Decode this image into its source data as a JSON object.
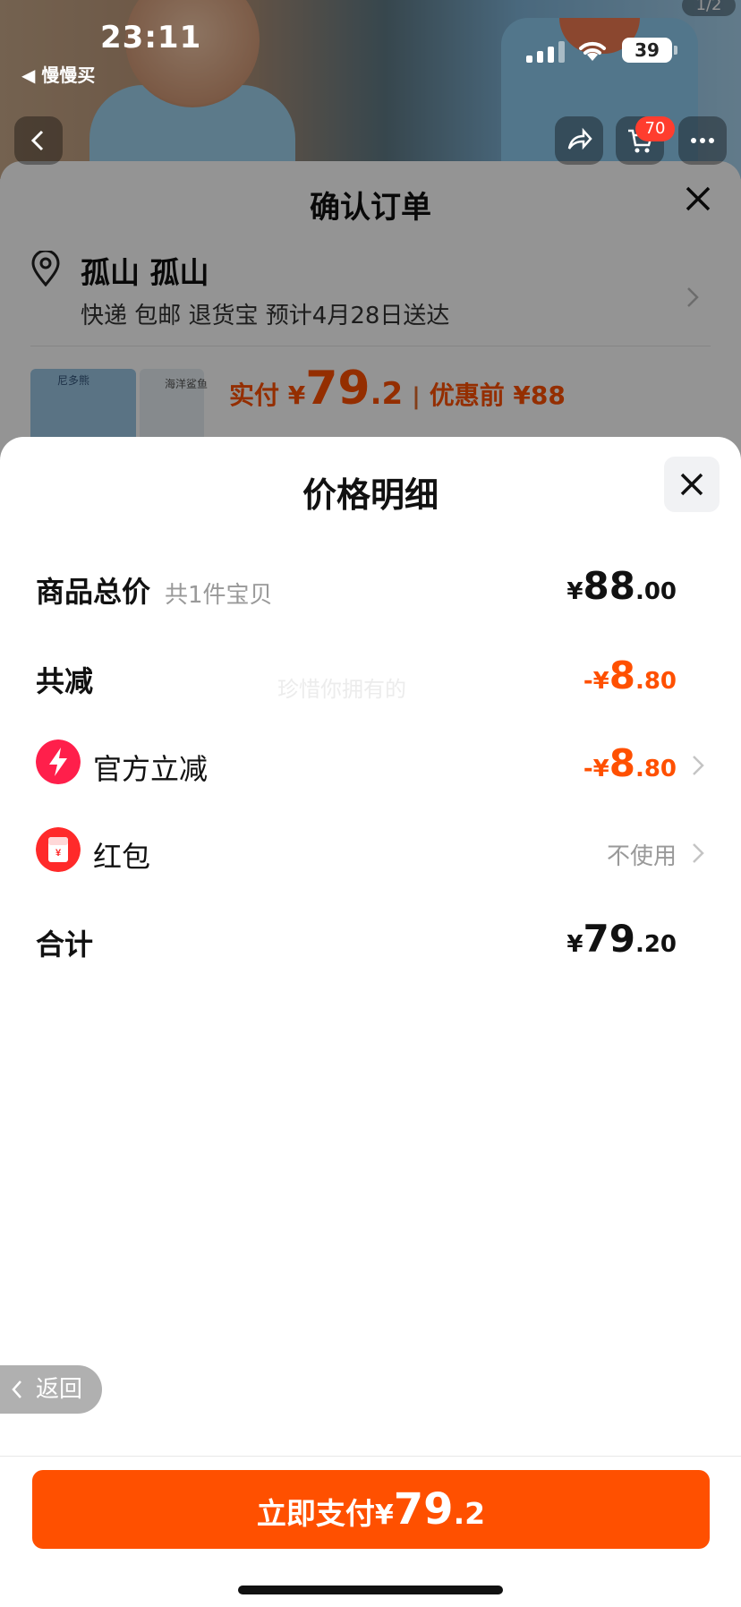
{
  "status_bar": {
    "time": "23:11",
    "back_app": "◀ 慢慢买",
    "battery": "39"
  },
  "background_page": {
    "pager": "1/2",
    "cart_badge": "70",
    "order": {
      "title": "确认订单",
      "address_name": "孤山 孤山",
      "address_detail": "快递 包邮 退货宝 预计4月28日送达",
      "thumb_text_1": "尼多熊",
      "thumb_text_2": "海洋鲨鱼",
      "paid_label": "实付 ¥",
      "paid_int": "79",
      "paid_dec": ".2",
      "separator": "|",
      "orig_price": "优惠前 ¥88"
    }
  },
  "price_sheet": {
    "title": "价格明细",
    "watermark": "珍惜你拥有的",
    "rows": [
      {
        "label": "商品总价",
        "sub": "共1件宝贝",
        "currency": "¥",
        "int": "88",
        "dec": ".00"
      },
      {
        "label": "共减",
        "currency": "-¥",
        "int": "8",
        "dec": ".80"
      },
      {
        "label": "官方立减",
        "currency": "-¥",
        "int": "8",
        "dec": ".80",
        "icon": "lightning-icon"
      },
      {
        "label": "红包",
        "value": "不使用",
        "icon": "red-envelope-icon"
      },
      {
        "label": "合计",
        "currency": "¥",
        "int": "79",
        "dec": ".20"
      }
    ]
  },
  "back_pill": "返回",
  "pay_button": {
    "label": "立即支付",
    "currency": "¥",
    "int": "79",
    "dec": ".2"
  },
  "colors": {
    "accent": "#ff5000",
    "official_icon": "#ff1f4b",
    "envelope_icon": "#ff2a2a",
    "muted_text": "#999999"
  }
}
